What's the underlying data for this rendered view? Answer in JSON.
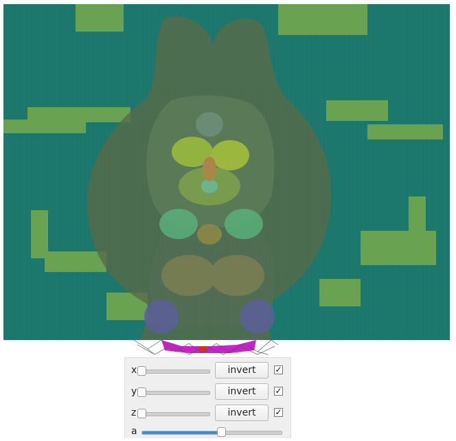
{
  "controls": [
    {
      "axis": "x",
      "button_label": "invert",
      "checkbox_mark": "✓",
      "checked": true,
      "slider_value": 0.0
    },
    {
      "axis": "y",
      "button_label": "invert",
      "checkbox_mark": "✓",
      "checked": true,
      "slider_value": 0.0
    },
    {
      "axis": "z",
      "button_label": "invert",
      "checkbox_mark": "✓",
      "checked": true,
      "slider_value": 0.0
    }
  ],
  "alpha": {
    "label": "a",
    "slider_value": 0.57
  },
  "colors": {
    "background_volume": "#1b766c",
    "accent": "#3a8fd6",
    "highlight": "#c8e03a",
    "region_magenta": "#cc1fcf"
  },
  "icons": [
    "checkmark-icon"
  ]
}
